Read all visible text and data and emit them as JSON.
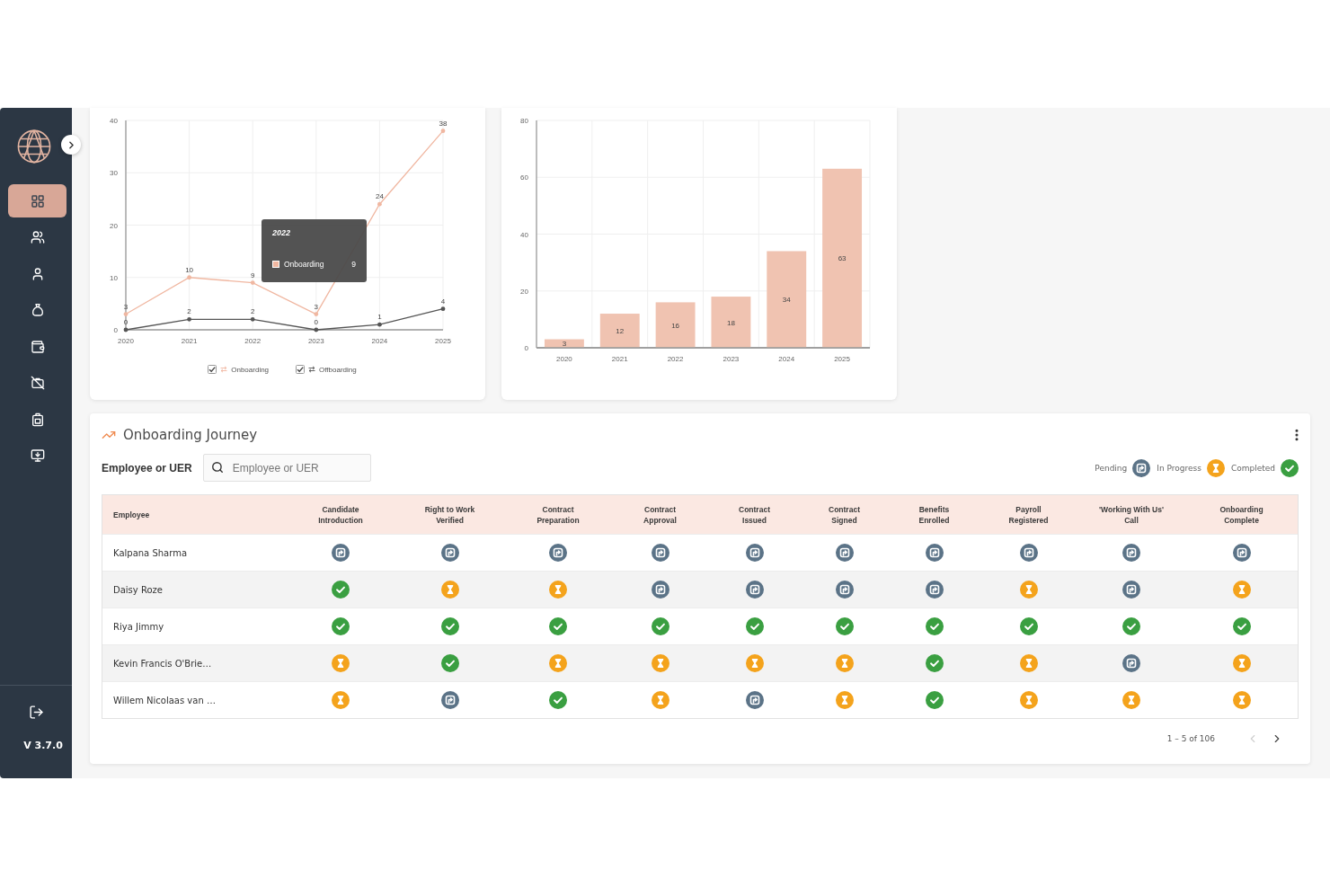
{
  "sidebar": {
    "nav_items": [
      {
        "selected": true
      },
      {
        "selected": false
      },
      {
        "selected": false
      },
      {
        "selected": false
      },
      {
        "selected": false
      },
      {
        "selected": false
      },
      {
        "selected": false
      },
      {
        "selected": false
      }
    ],
    "version": "V 3.7.0"
  },
  "line_chart": {
    "chart_data": {
      "type": "line",
      "categories": [
        "2020",
        "2021",
        "2022",
        "2023",
        "2024",
        "2025"
      ],
      "series": [
        {
          "name": "Onboarding",
          "color": "#f0b7a1",
          "values": [
            3,
            10,
            9,
            3,
            24,
            38
          ]
        },
        {
          "name": "Offboarding",
          "color": "#555555",
          "values": [
            0,
            2,
            2,
            0,
            1,
            4
          ]
        }
      ],
      "ylim": [
        0,
        40
      ],
      "yticks": [
        0,
        10,
        20,
        30,
        40
      ],
      "grid": true,
      "data_labels": true
    },
    "legend": [
      {
        "checked": true
      },
      {
        "checked": true
      }
    ],
    "tooltip": {
      "title": "2022",
      "label": "Onboarding",
      "value": "9"
    }
  },
  "bar_chart": {
    "chart_data": {
      "type": "bar",
      "categories": [
        "2020",
        "2021",
        "2022",
        "2023",
        "2024",
        "2025"
      ],
      "values": [
        3,
        12,
        16,
        18,
        34,
        63
      ],
      "ylim": [
        0,
        80
      ],
      "yticks": [
        0,
        20,
        40,
        60,
        80
      ],
      "grid": true,
      "data_labels": true
    }
  },
  "onboarding_journey": {
    "title": "Onboarding Journey",
    "filter": {
      "label": "Employee or UER",
      "placeholder": "Employee or UER"
    },
    "status_legend": [
      {
        "label": "Pending",
        "kind": "pending"
      },
      {
        "label": "In Progress",
        "kind": "in_progress"
      },
      {
        "label": "Completed",
        "kind": "completed"
      }
    ],
    "table": {
      "columns": [
        "Employee",
        "Candidate Introduction",
        "Right to Work Verified",
        "Contract Preparation",
        "Contract Approval",
        "Contract Issued",
        "Contract Signed",
        "Benefits Enrolled",
        "Payroll Registered",
        "'Working With Us' Call",
        "Onboarding Complete"
      ],
      "rows": [
        {
          "employee": "Kalpana Sharma",
          "steps": [
            {
              "kind": "pending"
            },
            {
              "kind": "pending"
            },
            {
              "kind": "pending"
            },
            {
              "kind": "pending"
            },
            {
              "kind": "pending"
            },
            {
              "kind": "pending"
            },
            {
              "kind": "pending"
            },
            {
              "kind": "pending"
            },
            {
              "kind": "pending"
            },
            {
              "kind": "pending"
            }
          ]
        },
        {
          "employee": "Daisy Roze",
          "steps": [
            {
              "kind": "completed"
            },
            {
              "kind": "in_progress"
            },
            {
              "kind": "in_progress"
            },
            {
              "kind": "pending"
            },
            {
              "kind": "pending"
            },
            {
              "kind": "pending"
            },
            {
              "kind": "pending"
            },
            {
              "kind": "in_progress"
            },
            {
              "kind": "pending"
            },
            {
              "kind": "in_progress"
            }
          ]
        },
        {
          "employee": "Riya Jimmy",
          "steps": [
            {
              "kind": "completed"
            },
            {
              "kind": "completed"
            },
            {
              "kind": "completed"
            },
            {
              "kind": "completed"
            },
            {
              "kind": "completed"
            },
            {
              "kind": "completed"
            },
            {
              "kind": "completed"
            },
            {
              "kind": "completed"
            },
            {
              "kind": "completed"
            },
            {
              "kind": "completed"
            }
          ]
        },
        {
          "employee": "Kevin Francis O'Brie…",
          "steps": [
            {
              "kind": "in_progress"
            },
            {
              "kind": "completed"
            },
            {
              "kind": "in_progress"
            },
            {
              "kind": "in_progress"
            },
            {
              "kind": "in_progress"
            },
            {
              "kind": "in_progress"
            },
            {
              "kind": "completed"
            },
            {
              "kind": "in_progress"
            },
            {
              "kind": "pending"
            },
            {
              "kind": "in_progress"
            }
          ]
        },
        {
          "employee": "Willem Nicolaas van …",
          "steps": [
            {
              "kind": "in_progress"
            },
            {
              "kind": "pending"
            },
            {
              "kind": "completed"
            },
            {
              "kind": "in_progress"
            },
            {
              "kind": "pending"
            },
            {
              "kind": "in_progress"
            },
            {
              "kind": "completed"
            },
            {
              "kind": "in_progress"
            },
            {
              "kind": "in_progress"
            },
            {
              "kind": "in_progress"
            }
          ]
        }
      ]
    },
    "pagination": {
      "range": "1 – 5 of 106",
      "buttons": [
        {
          "kind": "previous",
          "disabled": true
        },
        {
          "kind": "next",
          "disabled": false
        }
      ]
    }
  }
}
